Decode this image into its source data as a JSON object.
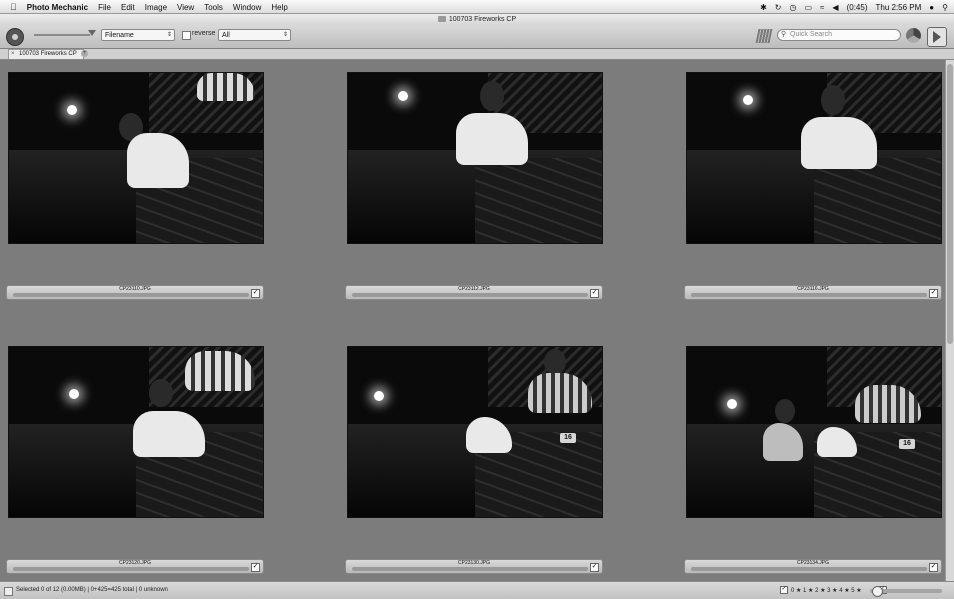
{
  "menubar": {
    "apple": "",
    "app_name": "Photo Mechanic",
    "menus": [
      "File",
      "Edit",
      "Image",
      "View",
      "Tools",
      "Window",
      "Help"
    ],
    "battery": "(0:45)",
    "clock": "Thu 2:56 PM",
    "user_icon": "user-icon",
    "spotlight_icon": "search-icon"
  },
  "window": {
    "title": "100703 Fireworks CP"
  },
  "toolbar": {
    "sort_select": "Filename",
    "reverse_label": "reverse",
    "filter_select": "All",
    "search_placeholder": "Quick Search"
  },
  "tabs": [
    {
      "label": "100703 Fireworks CP"
    }
  ],
  "thumbnails": [
    {
      "filename": "CP23110.JPG"
    },
    {
      "filename": "CP23112.JPG"
    },
    {
      "filename": "CP23116.JPG"
    },
    {
      "filename": "CP23120.JPG"
    },
    {
      "filename": "CP23130.JPG"
    },
    {
      "filename": "CP23134.JPG"
    }
  ],
  "statusbar": {
    "text": "Selected 0 of 12 (0.00MB) | 0+425=425 total | 0 unknown",
    "ratings": "0 ★ 1 ★ 2 ★ 3 ★ 4 ★ 5 ★"
  }
}
